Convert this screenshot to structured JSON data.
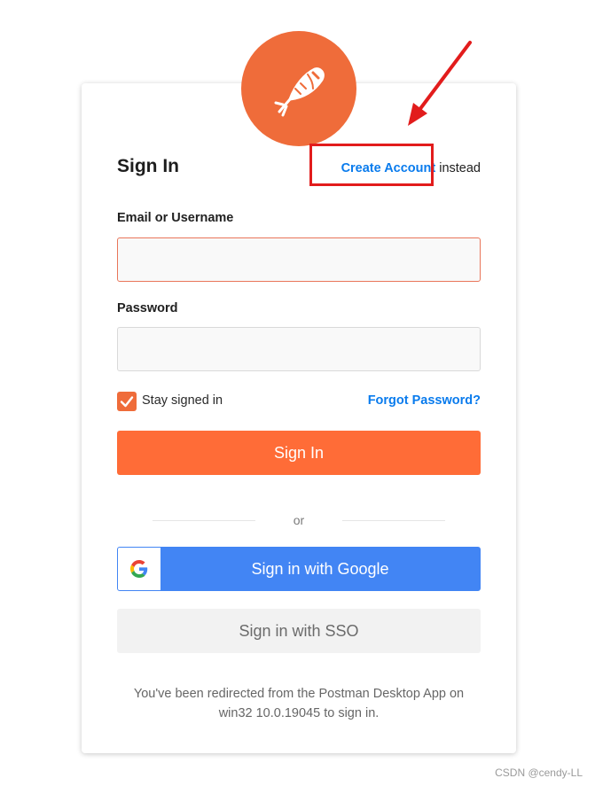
{
  "brand": {
    "logo_icon": "postman-astronaut-icon",
    "logo_color": "#ef6c3a"
  },
  "header": {
    "title": "Sign In",
    "create_account_link": "Create Account",
    "instead_text": "instead"
  },
  "form": {
    "email_label": "Email or Username",
    "email_value": "",
    "password_label": "Password",
    "password_value": "",
    "stay_signed_in_label": "Stay signed in",
    "stay_signed_in_checked": true,
    "forgot_password_link": "Forgot Password?",
    "sign_in_button": "Sign In"
  },
  "divider_text": "or",
  "social": {
    "google_button": "Sign in with Google",
    "sso_button": "Sign in with SSO"
  },
  "redirect_note": "You've been redirected from the Postman Desktop App on win32 10.0.19045 to sign in.",
  "watermark": "CSDN @cendy-LL",
  "colors": {
    "accent": "#ff6c37",
    "link": "#097bed",
    "google_blue": "#4285f4",
    "annotation_red": "#e21c1c"
  }
}
